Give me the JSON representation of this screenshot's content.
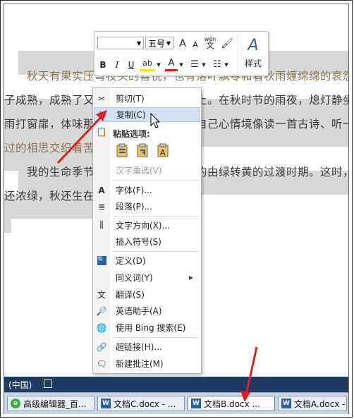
{
  "document": {
    "lines": [
      "　　秋天有果实压弯枝头的喜悦，也有落叶飘零和着秋雨缠绵绵的哀怨，更有",
      "子成熟，成熟了又怎样，终究要归于泥土。在秋时节的雨夜，熄灯静坐，听风",
      "雨打窗扉，体味那份惆怅，找到一份与自己心情境像读一首古诗、听一曲旧",
      "过的相思交织着苦",
      "　　我的生命季节似乎一直就在这秋天的由绿转黄的过渡时期。这时，花还",
      "还浓绿，秋还生在"
    ]
  },
  "mini_toolbar": {
    "font_name": "",
    "font_size": "五号",
    "grow_font": "A",
    "shrink_font": "A",
    "pinyin": "wén",
    "bold": "B",
    "italic": "I",
    "underline": "U",
    "highlight": "ab",
    "font_color": "A",
    "styles_label": "样式"
  },
  "context_menu": {
    "cut": "剪切(T)",
    "copy": "复制(C)",
    "paste_options": "粘贴选项:",
    "reconvert": "汉字重选(V)",
    "font": "字体(F)...",
    "paragraph": "段落(P)...",
    "text_direction": "文字方向(X)...",
    "insert_symbol": "插入符号(S)",
    "define": "定义(D)",
    "synonyms": "同义词(Y)",
    "translate": "翻译(S)",
    "english_assistant": "英语助手(A)",
    "bing_search": "使用 Bing 搜索(E)",
    "hyperlink": "超链接(H)...",
    "new_comment": "新建批注(M)"
  },
  "status_bar": {
    "language": "(中国)"
  },
  "taskbar": {
    "items": [
      "高级编辑器_百...",
      "文档C.docx - ...",
      "文档B.docx ...",
      "文档A.docx -"
    ]
  },
  "colors": {
    "highlight": "#d8d8d8",
    "menu_hover": "#d4e1f2",
    "status_bar": "#1f3a63",
    "arrow": "#e02020"
  }
}
